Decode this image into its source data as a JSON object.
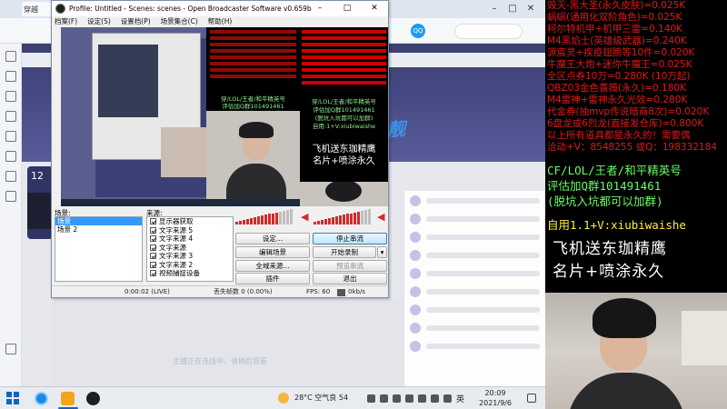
{
  "browser": {
    "tab_label": "穿越",
    "qq_icon_text": "QQ",
    "banner_text": "靓",
    "page_card_text": "12",
    "video_caption": "主播正在连线中，请稍后观看"
  },
  "obs": {
    "title": "Profile: Untitled - Scenes: scenes - Open Broadcaster Software v0.659b",
    "menu": [
      "档案(F)",
      "设定(S)",
      "设置档(P)",
      "场景集合(C)",
      "帮助(H)"
    ],
    "scenes_label": "场景:",
    "sources_label": "来源:",
    "scenes": [
      "场景",
      "场景 2"
    ],
    "selected_scene": "场景",
    "sources": [
      "显示器获取",
      "文字来源 5",
      "文字来源 4",
      "文字来源",
      "文字来源 3",
      "文字来源 2",
      "视频捕捉设备"
    ],
    "buttons": {
      "settings": "设定...",
      "stop_stream": "停止串流",
      "edit_scene": "编辑场景",
      "start_record": "开始录制",
      "global_sources": "全域来源...",
      "stop_preview": "预览串流",
      "plugins": "插件",
      "exit": "退出"
    },
    "status": {
      "time": "0:00:02 (LIVE)",
      "dropped": "丢失帧数 0 (0.00%)",
      "fps": "FPS: 60",
      "bitrate": "0kb/s"
    },
    "mixer_levels": {
      "desktop": 0.78,
      "microphone": 0.82
    },
    "preview_green": [
      "穿/LOL/王者/和平精英号",
      "评估加Q群101491461",
      "(脱坑入坑都可以加群)",
      "自用:1+V:xiubiwaishe"
    ],
    "preview_white": [
      "飞机送东珈精鹰",
      "名片+喷涂永久"
    ]
  },
  "overlay": {
    "red_lines": [
      "毁灭-黑大圣(永久皮肤)=0.025K",
      "蜗蜗(通用化双阶角色)=0.025K",
      "柯尔特机甲+机甲三雷=0.140K",
      "M4黑焰士(英雄级武器)=0.240K",
      "源宸灵+疾疫翅膀等10件=0.020K",
      "牛魔王大炮+迷你牛魔王=0.025K",
      "全区点券10万=0.280K (10万起)",
      "QBZ03金色蔷薇(永久)=0.180K",
      "M4雷神+雷神永久光效=0.280K",
      "代金券(抽mvp传说暗商8次)=0.020K",
      "6盘龙或6烈龙(直接发仓库)=0.800K",
      "以上所有道具都是永久的！需要偶",
      "洽动+V：8548255    或Q：198332184"
    ],
    "green_lines": [
      "CF/LOL/王者/和平精英号",
      "评估加Q群101491461",
      "(脱坑入坑都可以加群)"
    ],
    "yellow_line": "自用1.1+V:xiubiwaishe",
    "white_lines": [
      "飞机送东珈精鹰",
      "名片+喷涂永久"
    ]
  },
  "taskbar": {
    "weather": "28°C 空气良 54",
    "lang": "英",
    "time": "20:09",
    "date": "2021/9/6"
  },
  "colors": {
    "overlay_red": "#e11919",
    "overlay_green": "#66ff66",
    "overlay_yellow": "#ffee3a",
    "mixer_red": "#d12b2b",
    "scene_selected": "#3399ff"
  }
}
